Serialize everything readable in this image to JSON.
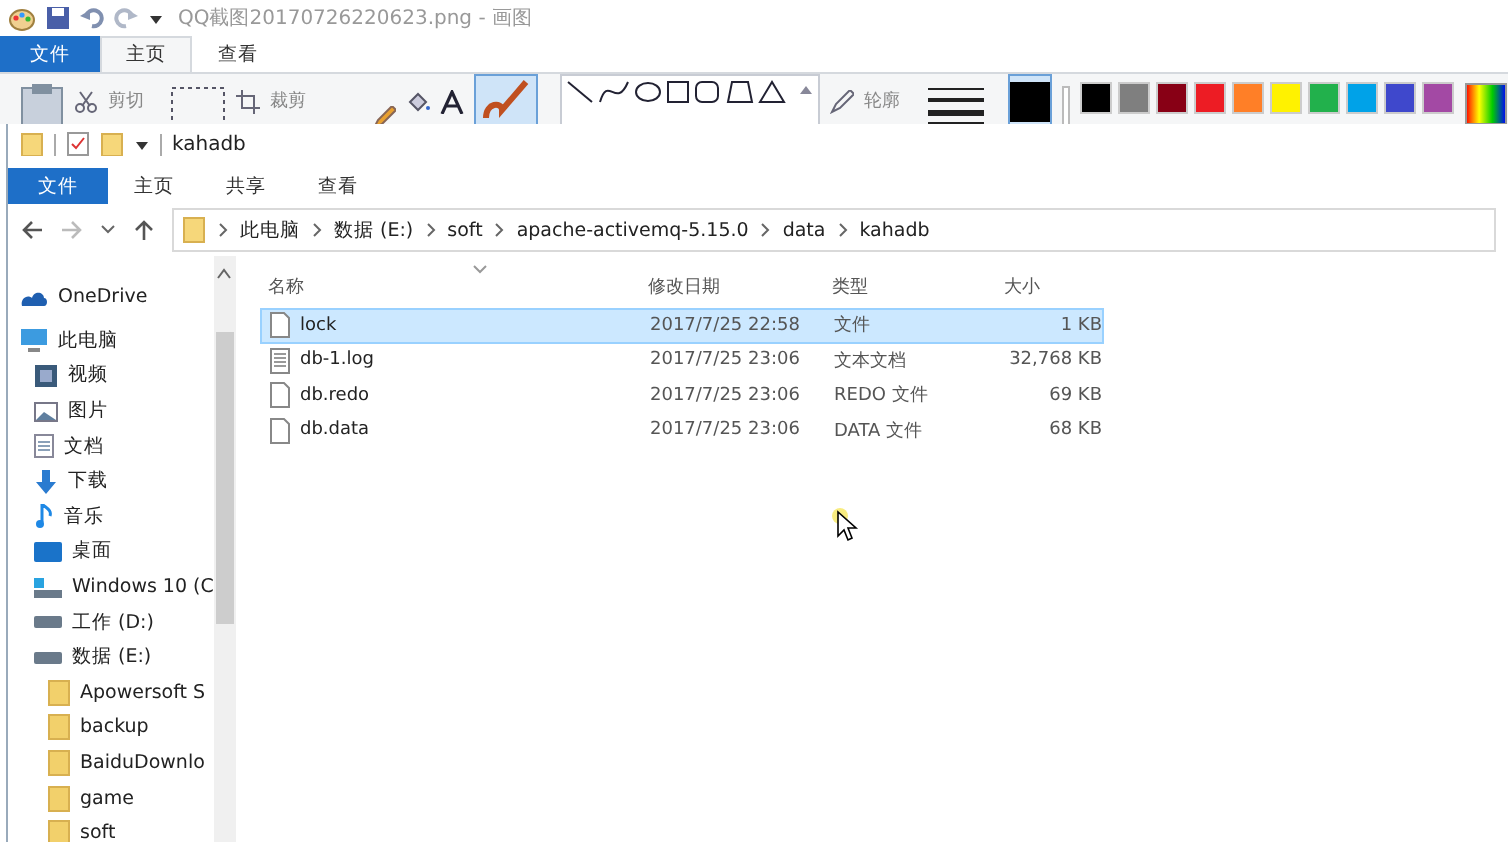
{
  "paint": {
    "title": "QQ截图20170726220623.png - 画图",
    "tabs": [
      {
        "label": "文件",
        "kind": "file",
        "selected": false
      },
      {
        "label": "主页",
        "kind": "tab",
        "selected": true
      },
      {
        "label": "查看",
        "kind": "tab",
        "selected": false
      }
    ],
    "tools": {
      "cut": "剪切",
      "crop": "裁剪",
      "outline": "轮廓"
    },
    "colors": [
      {
        "color": "#000000"
      },
      {
        "color": "#7f7f7f"
      },
      {
        "color": "#880015"
      },
      {
        "color": "#ed1c24"
      },
      {
        "color": "#ff7f27"
      },
      {
        "color": "#fff200"
      },
      {
        "color": "#22b14c"
      },
      {
        "color": "#00a2e8"
      },
      {
        "color": "#3f48cc"
      },
      {
        "color": "#a349a4"
      }
    ]
  },
  "explorer": {
    "title": "kahadb",
    "tabs": [
      {
        "label": "文件",
        "kind": "file",
        "selected": false
      },
      {
        "label": "主页",
        "kind": "tab",
        "selected": false
      },
      {
        "label": "共享",
        "kind": "tab",
        "selected": false
      },
      {
        "label": "查看",
        "kind": "tab",
        "selected": false
      }
    ],
    "breadcrumb": [
      "此电脑",
      "数据 (E:)",
      "soft",
      "apache-activemq-5.15.0",
      "data",
      "kahadb"
    ],
    "nav": [
      {
        "label": "OneDrive",
        "kind": "cloud"
      },
      {
        "label": "此电脑",
        "kind": "pc",
        "children": [
          {
            "label": "视频",
            "kind": "video"
          },
          {
            "label": "图片",
            "kind": "image"
          },
          {
            "label": "文档",
            "kind": "doc"
          },
          {
            "label": "下载",
            "kind": "download"
          },
          {
            "label": "音乐",
            "kind": "music"
          },
          {
            "label": "桌面",
            "kind": "desktop"
          },
          {
            "label": "Windows 10 (C",
            "kind": "sysdrive"
          },
          {
            "label": "工作 (D:)",
            "kind": "drive"
          },
          {
            "label": "数据 (E:)",
            "kind": "drive",
            "children": [
              {
                "label": "Apowersoft S",
                "kind": "folder"
              },
              {
                "label": "backup",
                "kind": "folder"
              },
              {
                "label": "BaiduDownlo",
                "kind": "folder"
              },
              {
                "label": "game",
                "kind": "folder"
              },
              {
                "label": "soft",
                "kind": "folder"
              }
            ]
          }
        ]
      }
    ],
    "columns": [
      "名称",
      "修改日期",
      "类型",
      "大小"
    ],
    "rows": [
      {
        "name": "lock",
        "kind": "file",
        "date": "2017/7/25 22:58",
        "type": "文件",
        "size": "1 KB",
        "selected": true
      },
      {
        "name": "db-1.log",
        "kind": "text",
        "date": "2017/7/25 23:06",
        "type": "文本文档",
        "size": "32,768 KB",
        "selected": false
      },
      {
        "name": "db.redo",
        "kind": "file",
        "date": "2017/7/25 23:06",
        "type": "REDO 文件",
        "size": "69 KB",
        "selected": false
      },
      {
        "name": "db.data",
        "kind": "file",
        "date": "2017/7/25 23:06",
        "type": "DATA 文件",
        "size": "68 KB",
        "selected": false
      }
    ]
  }
}
